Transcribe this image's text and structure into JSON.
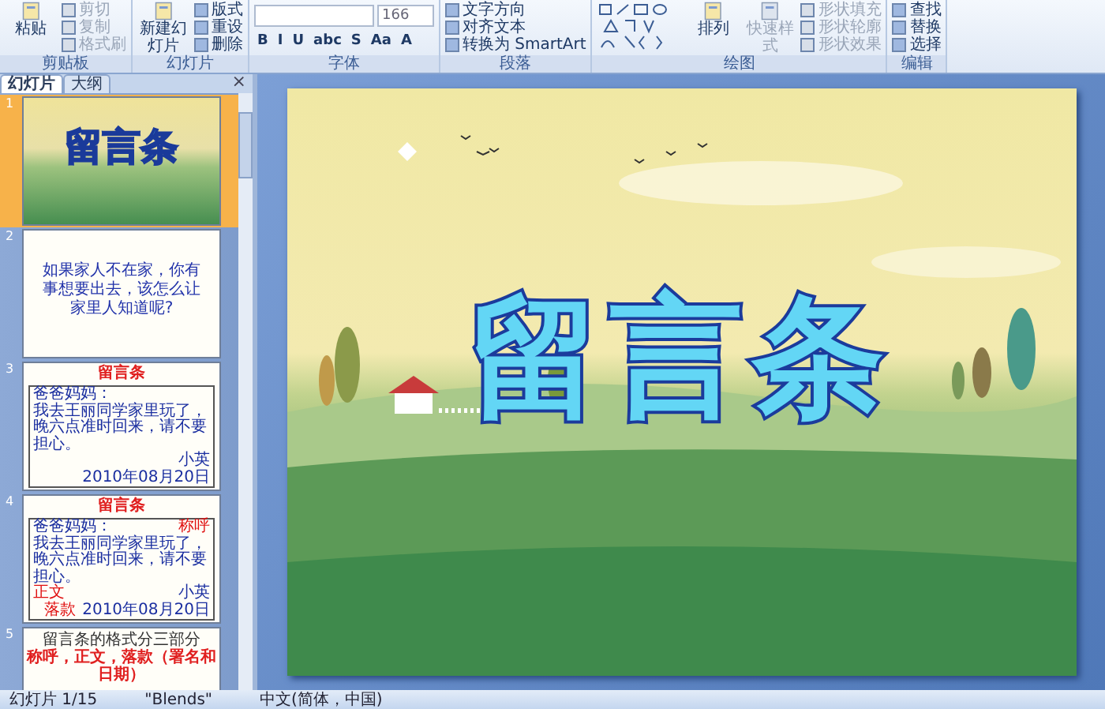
{
  "ribbon": {
    "groups": [
      {
        "label": "剪贴板",
        "large": [
          {
            "label": "粘贴",
            "disabled": false
          }
        ],
        "small": [
          {
            "label": "剪切",
            "disabled": true
          },
          {
            "label": "复制",
            "disabled": true
          },
          {
            "label": "格式刷",
            "disabled": true
          }
        ]
      },
      {
        "label": "幻灯片",
        "large": [
          {
            "label": "新建幻灯片",
            "disabled": false
          }
        ],
        "small": [
          {
            "label": "版式",
            "disabled": false
          },
          {
            "label": "重设",
            "disabled": false
          },
          {
            "label": "删除",
            "disabled": false
          }
        ]
      },
      {
        "label": "字体",
        "font_size": "166",
        "format_buttons": [
          "B",
          "I",
          "U",
          "abc",
          "S",
          "Aa",
          "A"
        ]
      },
      {
        "label": "段落",
        "small": [
          {
            "label": "文字方向",
            "disabled": false
          },
          {
            "label": "对齐文本",
            "disabled": false
          },
          {
            "label": "转换为 SmartArt",
            "disabled": false
          }
        ]
      },
      {
        "label": "绘图",
        "shapes": true,
        "large": [
          {
            "label": "排列",
            "disabled": false
          },
          {
            "label": "快速样式",
            "disabled": true
          }
        ],
        "small": [
          {
            "label": "形状填充",
            "disabled": true
          },
          {
            "label": "形状轮廓",
            "disabled": true
          },
          {
            "label": "形状效果",
            "disabled": true
          }
        ]
      },
      {
        "label": "编辑",
        "small": [
          {
            "label": "查找",
            "disabled": false
          },
          {
            "label": "替换",
            "disabled": false
          },
          {
            "label": "选择",
            "disabled": false
          }
        ]
      }
    ]
  },
  "panel": {
    "tabs": [
      {
        "label": "幻灯片",
        "selected": true
      },
      {
        "label": "大纲",
        "selected": false
      }
    ],
    "close": "×"
  },
  "slides": [
    {
      "number": "1",
      "selected": true,
      "kind": "title",
      "title": "留言条"
    },
    {
      "number": "2",
      "selected": false,
      "kind": "text",
      "text": "如果家人不在家，你有事想要出去，该怎么让家里人知道呢?"
    },
    {
      "number": "3",
      "selected": false,
      "kind": "letter",
      "title": "留言条",
      "greeting": "爸爸妈妈：",
      "body": "我去王丽同学家里玩了，晚六点准时回来，请不要担心。",
      "signature": "小英",
      "date": "2010年08月20日"
    },
    {
      "number": "4",
      "selected": false,
      "kind": "letter",
      "title": "留言条",
      "greeting": "爸爸妈妈：",
      "body": "我去王丽同学家里玩了，晚六点准时回来，请不要担心。",
      "signature": "小英",
      "date": "2010年08月20日",
      "notes": {
        "greeting": "称呼",
        "body": "正文",
        "closing": "落款"
      }
    },
    {
      "number": "5",
      "selected": false,
      "kind": "heading",
      "title": "留言条的格式分三部分",
      "subtitle": "称呼，正文，落款（署名和日期）"
    }
  ],
  "main_slide": {
    "title": "留言条"
  },
  "status_bar": [
    "幻灯片 1/15",
    "\"Blends\"",
    "中文(简体，中国)"
  ]
}
